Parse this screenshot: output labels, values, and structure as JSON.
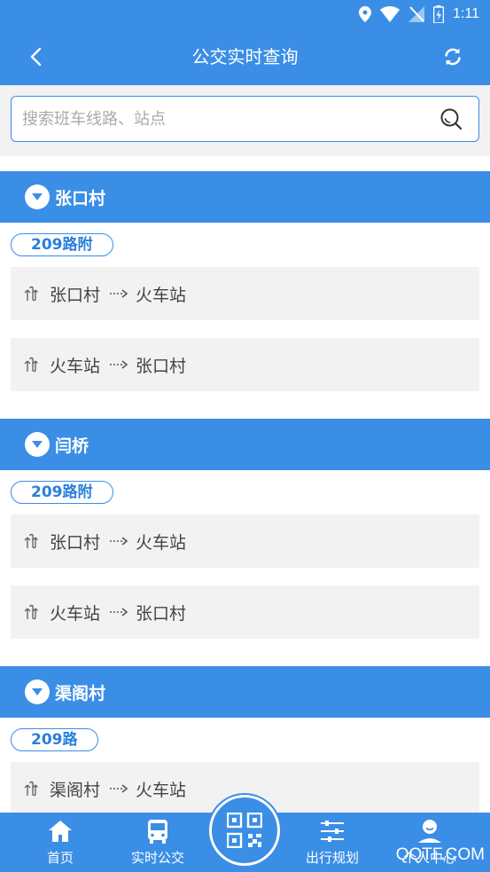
{
  "status_bar": {
    "time": "1:11"
  },
  "app_bar": {
    "title": "公交实时查询"
  },
  "search": {
    "placeholder": "搜索班车线路、站点",
    "value": ""
  },
  "sections": [
    {
      "stop_name": "张口村",
      "route": "209路附",
      "directions": [
        {
          "from": "张口村",
          "to": "火车站"
        },
        {
          "from": "火车站",
          "to": "张口村"
        }
      ]
    },
    {
      "stop_name": "闫桥",
      "route": "209路附",
      "directions": [
        {
          "from": "张口村",
          "to": "火车站"
        },
        {
          "from": "火车站",
          "to": "张口村"
        }
      ]
    },
    {
      "stop_name": "渠阁村",
      "route": "209路",
      "directions": [
        {
          "from": "渠阁村",
          "to": "火车站"
        }
      ]
    }
  ],
  "tabbar": {
    "home": "首页",
    "realtime_bus": "实时公交",
    "trip_planning": "出行规划",
    "profile": "个人中心"
  },
  "watermark": "QQTF.COM",
  "colors": {
    "primary": "#3a8ee6",
    "card_bg": "#f2f2f2",
    "route_tag_text": "#2a7fdc"
  },
  "icons": [
    "location-icon",
    "wifi-icon",
    "signal-icon",
    "battery-icon",
    "back-icon",
    "refresh-icon",
    "search-icon",
    "caret-down-icon",
    "swap-direction-icon",
    "dotted-arrow-icon",
    "home-icon",
    "bus-icon",
    "qr-code-icon",
    "sliders-icon",
    "user-icon"
  ]
}
